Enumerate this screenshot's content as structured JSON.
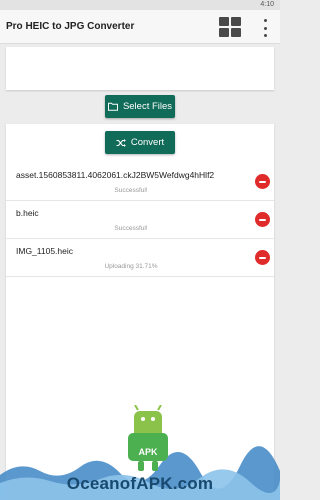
{
  "status_bar": {
    "time": "4:10"
  },
  "app_bar": {
    "title": "Pro HEIC to JPG Converter"
  },
  "actions": {
    "select_label": "Select Files",
    "convert_label": "Convert"
  },
  "files": [
    {
      "name": "asset.1560853811.4062061.ckJ2BW5Wefdwg4hHlf2",
      "status": "Successful!"
    },
    {
      "name": "b.heic",
      "status": "Successful!"
    },
    {
      "name": "IMG_1105.heic",
      "status": "Uploading 31.71%"
    }
  ],
  "watermark": {
    "text": "OceanofAPK.com",
    "badge": "APK"
  },
  "colors": {
    "accent": "#116b59",
    "remove": "#e02b2b",
    "watermark_text": "#18496e"
  },
  "icons": {
    "grid": "grid-icon",
    "more": "more-vertical-icon",
    "folder": "folder-icon",
    "shuffle": "shuffle-icon",
    "remove": "remove-icon"
  }
}
